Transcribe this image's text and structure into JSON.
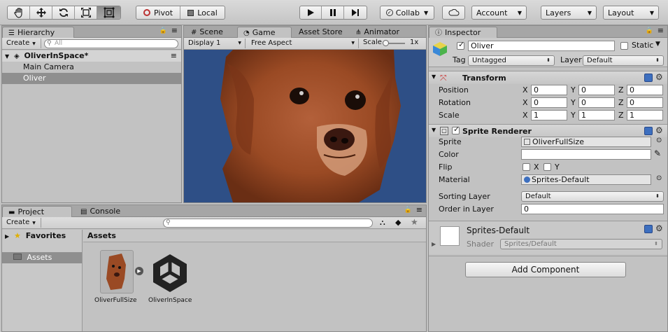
{
  "toolbar": {
    "tools": [
      "hand-tool-icon",
      "move-tool-icon",
      "rotate-tool-icon",
      "scale-tool-icon",
      "rect-tool-icon"
    ],
    "pivot_label": "Pivot",
    "local_label": "Local",
    "collab_label": "Collab",
    "account_label": "Account",
    "layers_label": "Layers",
    "layout_label": "Layout"
  },
  "hierarchy": {
    "tab": "Hierarchy",
    "create_label": "Create",
    "search_placeholder": "All",
    "scene_name": "OliverInSpace*",
    "items": [
      "Main Camera",
      "Oliver"
    ],
    "selected_index": 1
  },
  "game": {
    "tabs": [
      "Scene",
      "Game",
      "Asset Store",
      "Animator"
    ],
    "active_tab": "Game",
    "display": "Display 1",
    "aspect": "Free Aspect",
    "scale_label": "Scale",
    "scale_value": "1x",
    "background_color": "#2e4f86"
  },
  "project": {
    "tabs": [
      "Project",
      "Console"
    ],
    "create_label": "Create",
    "favorites_label": "Favorites",
    "assets_label": "Assets",
    "assets_header": "Assets",
    "assets": [
      "OliverFullSize",
      "OliverInSpace"
    ]
  },
  "inspector": {
    "tab": "Inspector",
    "object_name": "Oliver",
    "static_label": "Static",
    "tag_label": "Tag",
    "tag_value": "Untagged",
    "layer_label": "Layer",
    "layer_value": "Default",
    "transform": {
      "title": "Transform",
      "position_label": "Position",
      "rotation_label": "Rotation",
      "scale_label": "Scale",
      "axis_x": "X",
      "axis_y": "Y",
      "axis_z": "Z",
      "position": [
        "0",
        "0",
        "0"
      ],
      "rotation": [
        "0",
        "0",
        "0"
      ],
      "scale": [
        "1",
        "1",
        "1"
      ]
    },
    "sprite_renderer": {
      "title": "Sprite Renderer",
      "sprite_label": "Sprite",
      "sprite_value": "OliverFullSize",
      "color_label": "Color",
      "flip_label": "Flip",
      "flip_x": "X",
      "flip_y": "Y",
      "material_label": "Material",
      "material_value": "Sprites-Default",
      "sorting_layer_label": "Sorting Layer",
      "sorting_layer_value": "Default",
      "order_label": "Order in Layer",
      "order_value": "0"
    },
    "material": {
      "name": "Sprites-Default",
      "shader_label": "Shader",
      "shader_value": "Sprites/Default"
    },
    "add_component_label": "Add Component"
  }
}
